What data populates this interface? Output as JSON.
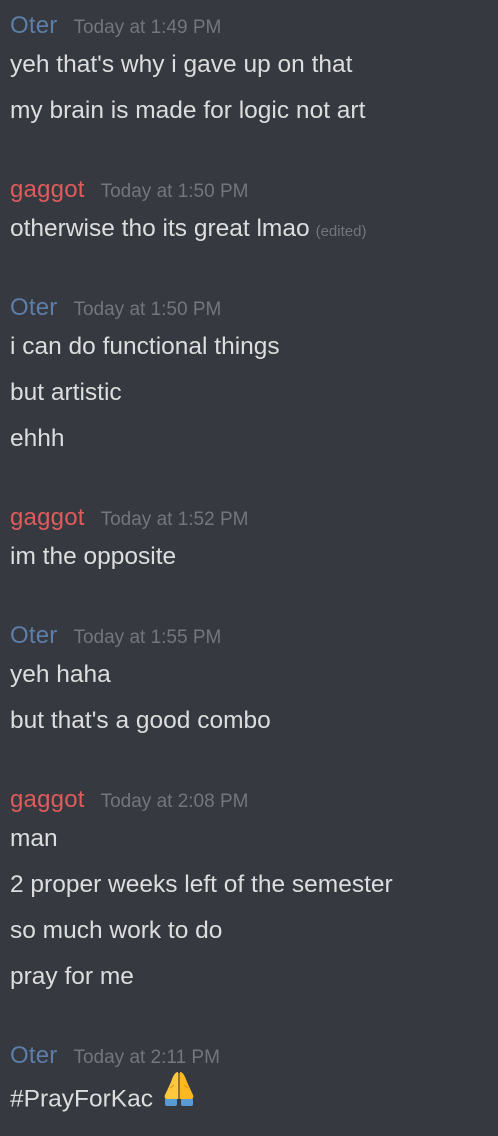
{
  "messages": [
    {
      "author": "Oter",
      "timestamp": "Today at 1:49 PM",
      "lines": [
        "yeh that's why i gave up on that",
        "my brain is made for logic not art"
      ]
    },
    {
      "author": "gaggot",
      "timestamp": "Today at 1:50 PM",
      "lines": [
        "otherwise tho its great lmao"
      ],
      "edited_label": "(edited)"
    },
    {
      "author": "Oter",
      "timestamp": "Today at 1:50 PM",
      "lines": [
        "i can do functional things",
        "but artistic",
        "ehhh"
      ]
    },
    {
      "author": "gaggot",
      "timestamp": "Today at 1:52 PM",
      "lines": [
        "im the opposite"
      ]
    },
    {
      "author": "Oter",
      "timestamp": "Today at 1:55 PM",
      "lines": [
        "yeh haha",
        "but that's a good combo"
      ]
    },
    {
      "author": "gaggot",
      "timestamp": "Today at 2:08 PM",
      "lines": [
        "man",
        "2 proper weeks left of the semester",
        "so much work to do",
        "pray for me"
      ]
    },
    {
      "author": "Oter",
      "timestamp": "Today at 2:11 PM",
      "lines": [
        "#PrayForKac"
      ],
      "emoji": "folded-hands-icon"
    }
  ],
  "colors": {
    "background": "#36393f",
    "oter": "#5c7ea8",
    "gaggot": "#e05b5b",
    "timestamp": "#72767d",
    "text": "#dcddde"
  }
}
